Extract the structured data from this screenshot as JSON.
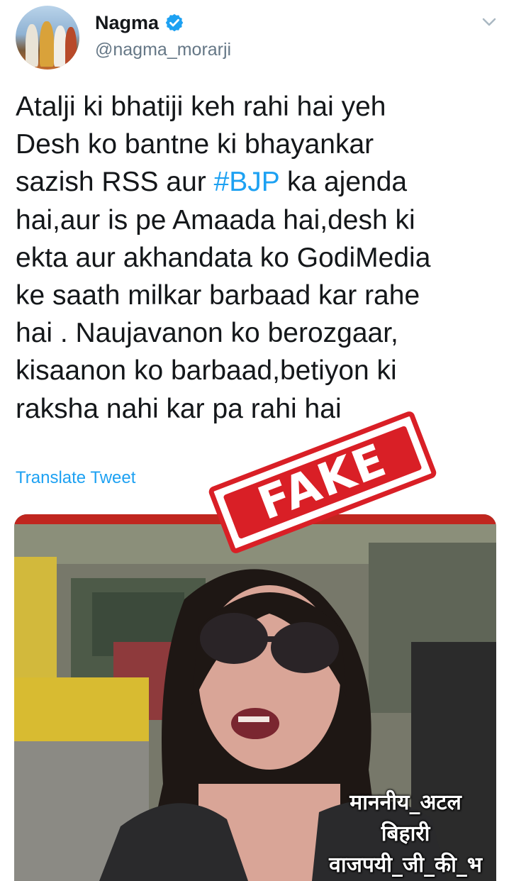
{
  "tweet": {
    "author_name": "Nagma",
    "author_handle": "@nagma_morarji",
    "text_lines": [
      "Atalji ki bhatiji keh rahi hai yeh",
      "Desh ko bantne ki bhayankar",
      "sazish RSS aur ",
      "#BJP",
      " ka ajenda",
      "hai,aur is pe Amaada hai,desh ki",
      "ekta aur akhandata ko GodiMedia",
      "ke saath milkar barbaad kar rahe",
      "hai . Naujavanon ko berozgaar,",
      "kisaanon ko barbaad,betiyon ki",
      "raksha nahi kar pa rahi hai"
    ],
    "translate_label": "Translate Tweet"
  },
  "media": {
    "caption_lines": [
      "माननीय_अटल",
      "बिहारी",
      "वाजपयी_जी_की_भ"
    ]
  },
  "stamp": {
    "label": "FAKE",
    "color": "#d91f26"
  },
  "colors": {
    "link": "#1da1f2",
    "verified": "#1da1f2",
    "secondary_text": "#657786"
  },
  "icons": {
    "verified": "verified-badge-icon",
    "menu": "chevron-down-icon"
  }
}
